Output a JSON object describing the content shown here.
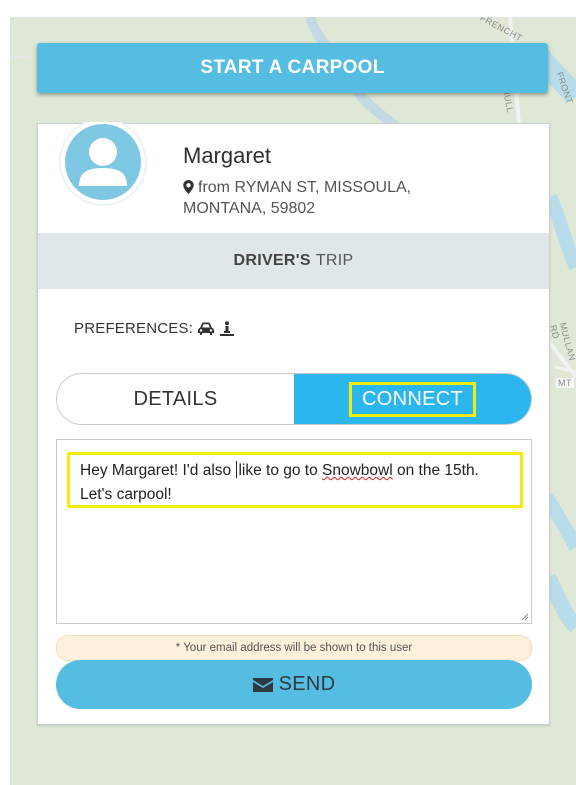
{
  "map": {
    "street_labels": [
      "FRENCHT",
      "MULL",
      "FRONT",
      "MULLAN RD",
      "MT"
    ]
  },
  "header": {
    "start_carpool_label": "START A CARPOOL"
  },
  "profile": {
    "name": "Margaret",
    "address_line1": "from RYMAN ST, MISSOULA,",
    "address_line2": "MONTANA, 59802",
    "icons": [
      "user-avatar-icon",
      "map-marker-icon"
    ]
  },
  "trip": {
    "type_bold": "DRIVER'S",
    "type_rest": "TRIP"
  },
  "preferences": {
    "label": "PREFERENCES:",
    "icons": [
      "car-icon",
      "person-seat-icon"
    ]
  },
  "tabs": {
    "details_label": "DETAILS",
    "connect_label": "CONNECT",
    "active": "CONNECT"
  },
  "message": {
    "part1": "Hey Margaret! I'd also ",
    "part2": "like to go to ",
    "misspelled": "Snowbowl",
    "part3": " on the 15th. Let's carpool!"
  },
  "notice": {
    "text": "* Your email address will be shown to this user"
  },
  "send": {
    "label": "SEND",
    "icon": "envelope-icon"
  },
  "colors": {
    "accent": "#55bde1",
    "active_tab": "#2bb7ee",
    "highlight": "#f4ec0e",
    "trip_bar": "#dfe7ea",
    "notice_bg": "#fdf1dc",
    "map_bg": "#dfe8d6",
    "river": "#b9dcea"
  }
}
